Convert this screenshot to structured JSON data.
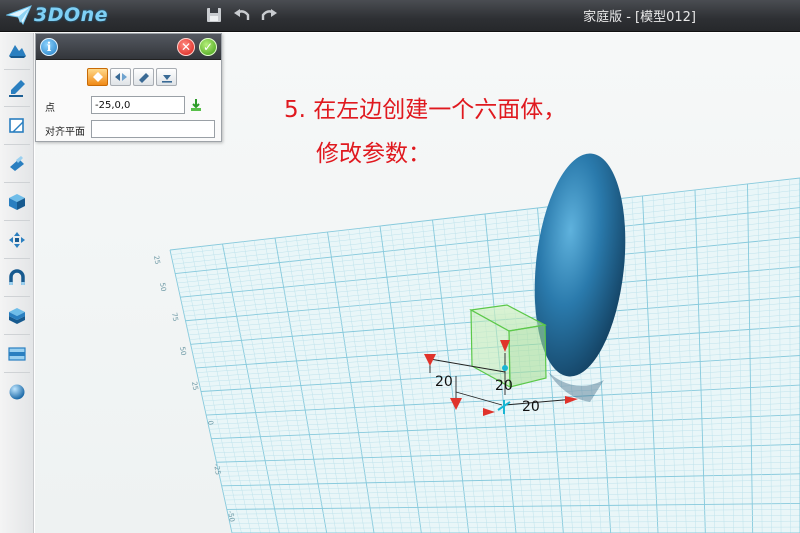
{
  "app": {
    "logo_text": "3DOne",
    "window_title": "家庭版 - [模型012]",
    "colors": {
      "accent": "#7fd0f5",
      "instruction": "#e0191f",
      "grid": "#7dc4d9"
    }
  },
  "quick_toolbar": [
    {
      "name": "save-icon"
    },
    {
      "name": "undo-icon"
    },
    {
      "name": "redo-icon"
    }
  ],
  "sidebar": {
    "items": [
      {
        "icon": "basic-solid-icon"
      },
      {
        "icon": "sketch-pencil-icon"
      },
      {
        "icon": "sketch-edit-icon"
      },
      {
        "icon": "special-modeling-icon"
      },
      {
        "icon": "feature-cube-icon"
      },
      {
        "icon": "transform-move-icon"
      },
      {
        "icon": "combine-magnet-icon"
      },
      {
        "icon": "library-box-icon"
      },
      {
        "icon": "view-panel-icon"
      },
      {
        "icon": "material-sphere-icon"
      }
    ]
  },
  "panel": {
    "mode_buttons": [
      "diamond-mode-icon",
      "mirror-mode-icon",
      "pen-mode-icon",
      "download-mode-icon"
    ],
    "point_label": "点",
    "point_value": "-25,0,0",
    "align_label": "对齐平面",
    "align_value": ""
  },
  "instruction": {
    "line1": "5. 在左边创建一个六面体，",
    "line2": "修改参数："
  },
  "dimensions": {
    "width": "20",
    "height": "20",
    "depth": "20"
  },
  "grid_ticks": [
    "25",
    "50",
    "75",
    "50",
    "25",
    "0",
    "-25",
    "-50"
  ]
}
